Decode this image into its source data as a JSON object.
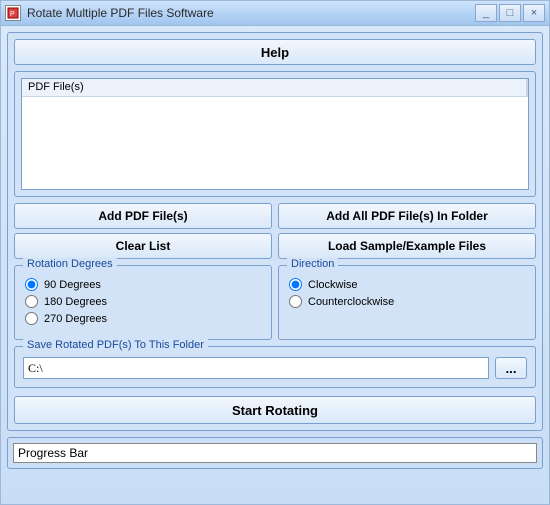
{
  "window": {
    "title": "Rotate Multiple PDF Files Software"
  },
  "help": {
    "label": "Help"
  },
  "list": {
    "column_header": "PDF File(s)"
  },
  "buttons": {
    "add": "Add PDF File(s)",
    "add_folder": "Add All PDF File(s) In Folder",
    "clear": "Clear List",
    "load_sample": "Load Sample/Example Files",
    "start": "Start Rotating",
    "browse": "..."
  },
  "rotation": {
    "legend": "Rotation Degrees",
    "options": [
      "90 Degrees",
      "180 Degrees",
      "270 Degrees"
    ],
    "selected": "90 Degrees"
  },
  "direction": {
    "legend": "Direction",
    "options": [
      "Clockwise",
      "Counterclockwise"
    ],
    "selected": "Clockwise"
  },
  "save": {
    "legend": "Save Rotated PDF(s) To This Folder",
    "path": "C:\\"
  },
  "progress": {
    "label": "Progress Bar"
  }
}
